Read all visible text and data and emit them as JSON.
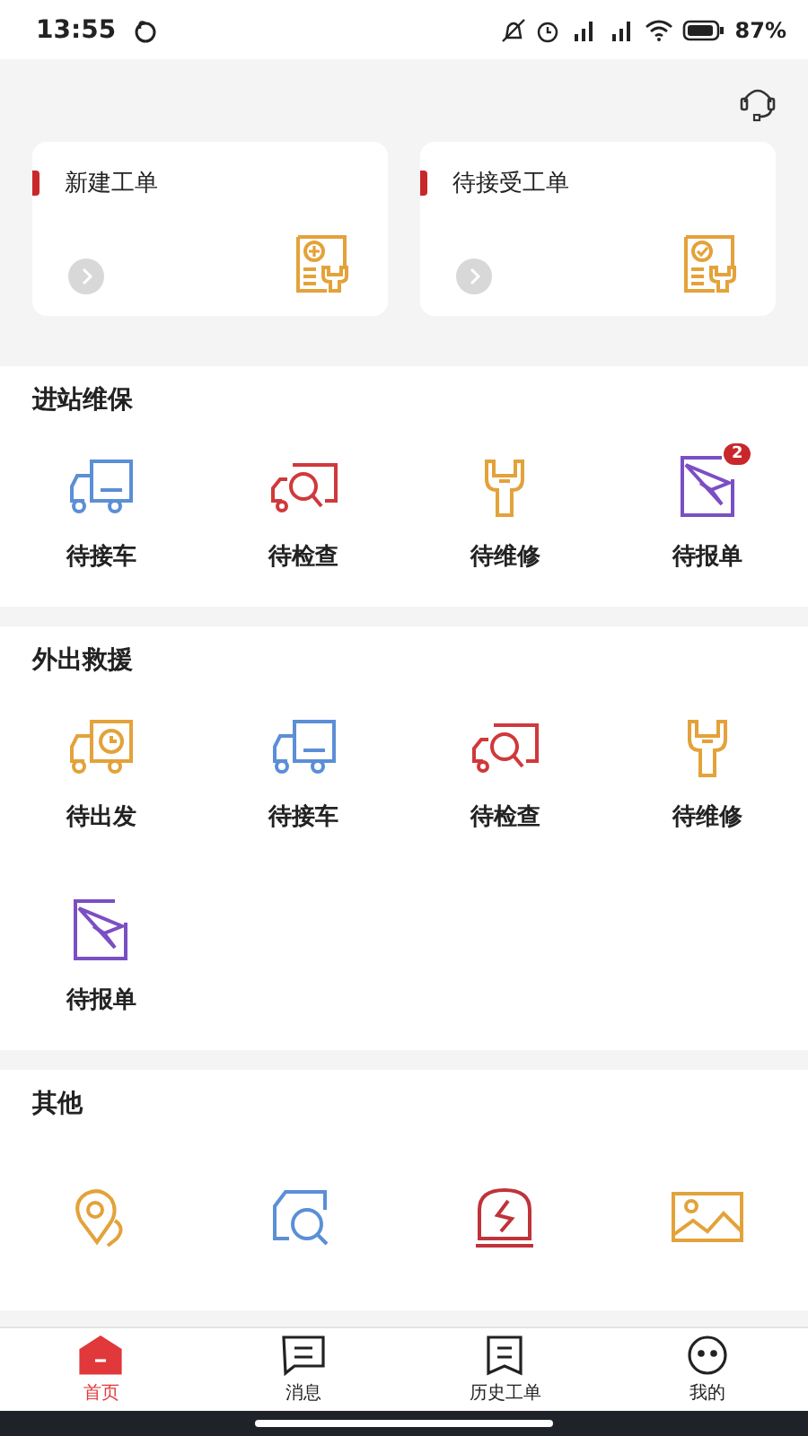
{
  "status_bar": {
    "time": "13:55",
    "battery": "87%"
  },
  "cards": [
    {
      "title": "新建工单",
      "kind": "plus"
    },
    {
      "title": "待接受工单",
      "kind": "check"
    }
  ],
  "sections": [
    {
      "title": "进站维保",
      "items": [
        {
          "label": "待接车",
          "kind": "truck"
        },
        {
          "label": "待检查",
          "kind": "inspect"
        },
        {
          "label": "待维修",
          "kind": "wrench"
        },
        {
          "label": "待报单",
          "kind": "send",
          "badge": "2"
        }
      ]
    },
    {
      "title": "外出救援",
      "items": [
        {
          "label": "待出发",
          "kind": "depart"
        },
        {
          "label": "待接车",
          "kind": "truck"
        },
        {
          "label": "待检查",
          "kind": "inspect"
        },
        {
          "label": "待维修",
          "kind": "wrench"
        },
        {
          "label": "待报单",
          "kind": "send"
        }
      ]
    },
    {
      "title": "其他",
      "items": [
        {
          "kind": "pin"
        },
        {
          "kind": "lookup"
        },
        {
          "kind": "alarm"
        },
        {
          "kind": "album"
        }
      ]
    }
  ],
  "tabs": [
    {
      "label": "首页",
      "kind": "home",
      "selected": true
    },
    {
      "label": "消息",
      "kind": "chat",
      "selected": false
    },
    {
      "label": "历史工单",
      "kind": "note",
      "selected": false
    },
    {
      "label": "我的",
      "kind": "face",
      "selected": false
    }
  ]
}
